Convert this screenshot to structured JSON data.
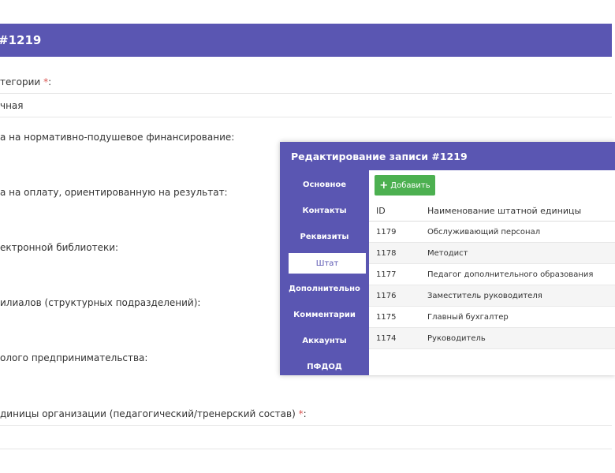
{
  "background": {
    "header_title": "#1219",
    "fields": [
      {
        "label": "тегории",
        "required": true,
        "suffix": ":",
        "value": "чная"
      },
      {
        "label": "а на нормативно-подушевое финансирование:",
        "required": false
      },
      {
        "label": "а на оплату, ориентированную на результат:",
        "required": false
      },
      {
        "label": "ектронной библиотеки:",
        "required": false
      },
      {
        "label": "илиалов (структурных подразделений):",
        "required": false
      },
      {
        "label": "олого предпринимательства:",
        "required": false
      },
      {
        "label": "диницы организации (педагогический/тренерский состав)",
        "required": true,
        "suffix": ":"
      }
    ],
    "req_mark": "*"
  },
  "modal": {
    "title": "Редактирование записи #1219",
    "sidebar": [
      {
        "label": "Основное",
        "active": false
      },
      {
        "label": "Контакты",
        "active": false
      },
      {
        "label": "Реквизиты",
        "active": false
      },
      {
        "label": "Штат",
        "active": true
      },
      {
        "label": "Дополнительно",
        "active": false
      },
      {
        "label": "Комментарии",
        "active": false
      },
      {
        "label": "Аккаунты",
        "active": false
      },
      {
        "label": "ПФДОД",
        "active": false
      }
    ],
    "add_button": {
      "icon": "plus-icon",
      "label": "Добавить",
      "color": "#4cb050"
    },
    "table": {
      "columns": [
        "ID",
        "Наименование штатной единицы"
      ],
      "rows": [
        [
          "1179",
          "Обслуживающий персонал"
        ],
        [
          "1178",
          "Методист"
        ],
        [
          "1177",
          "Педагог дополнительного образования"
        ],
        [
          "1176",
          "Заместитель руководителя"
        ],
        [
          "1175",
          "Главный бухгалтер"
        ],
        [
          "1174",
          "Руководитель"
        ]
      ]
    }
  },
  "colors": {
    "accent": "#5a56b2",
    "success": "#4cb050",
    "required": "#d9534f"
  }
}
